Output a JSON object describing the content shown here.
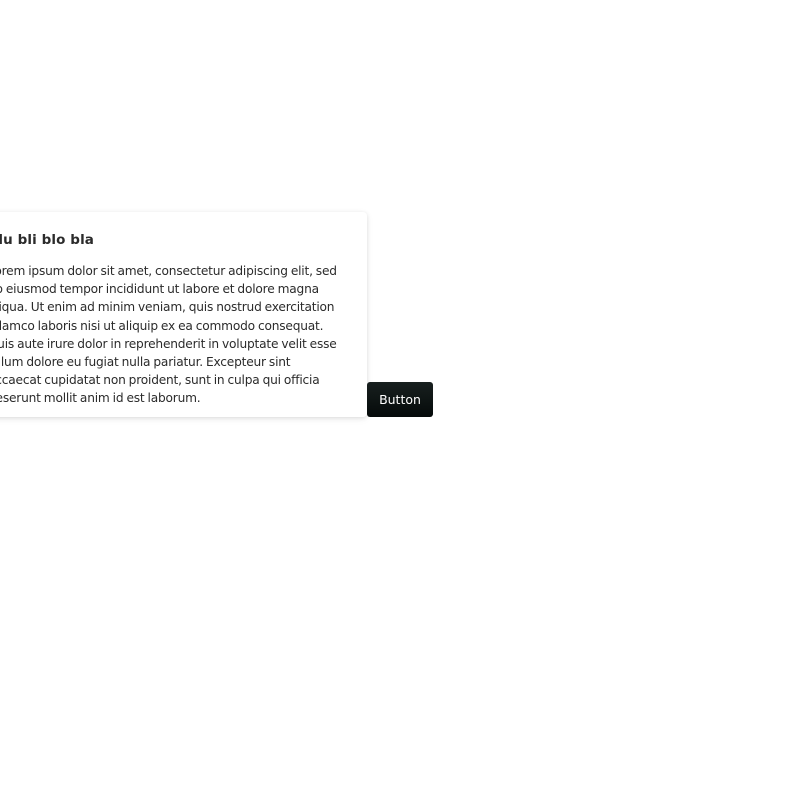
{
  "popover": {
    "title": "Blu bli blo bla",
    "body": "Lorem ipsum dolor sit amet, consectetur adipiscing elit, sed do eiusmod tempor incididunt ut labore et dolore magna aliqua. Ut enim ad minim veniam, quis nostrud exercitation ullamco laboris nisi ut aliquip ex ea commodo consequat. Duis aute irure dolor in reprehenderit in voluptate velit esse cillum dolore eu fugiat nulla pariatur. Excepteur sint occaecat cupidatat non proident, sunt in culpa qui officia deserunt mollit anim id est laborum."
  },
  "trigger": {
    "label": "Button"
  },
  "colors": {
    "button_background": "#0b1212",
    "button_text": "#ffffff",
    "popover_background": "#ffffff",
    "text": "#2b2b2b"
  }
}
